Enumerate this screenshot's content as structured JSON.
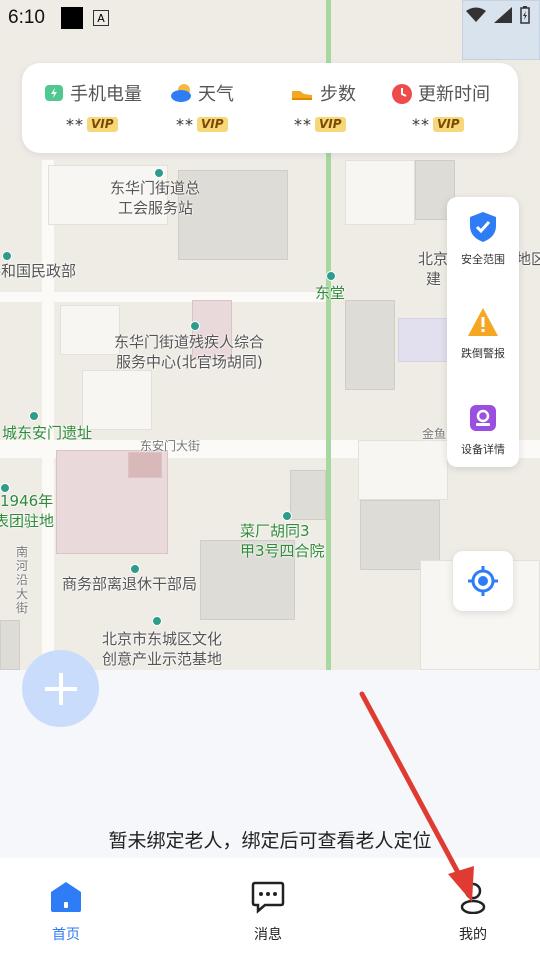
{
  "status_bar": {
    "time": "6:10",
    "a_icon": "A"
  },
  "metrics": [
    {
      "label": "手机电量",
      "value": "**",
      "badge": "VIP",
      "icon": "battery-icon"
    },
    {
      "label": "天气",
      "value": "**",
      "badge": "VIP",
      "icon": "weather-cloud-icon"
    },
    {
      "label": "步数",
      "value": "**",
      "badge": "VIP",
      "icon": "shoe-icon"
    },
    {
      "label": "更新时间",
      "value": "**",
      "badge": "VIP",
      "icon": "clock-icon"
    }
  ],
  "side_panel": {
    "safe_zone": "安全范围",
    "fall_alert": "跌倒警报",
    "device_details": "设备详情"
  },
  "map_labels": {
    "poi1_line1": "东华门街道总",
    "poi1_line2": "工会服务站",
    "poi2": "共和国民政部",
    "poi3": "东堂",
    "poi4_line1": "北京",
    "poi4_line2": "建",
    "poi5": "地区",
    "poi6_line1": "东华门街道残疾人综合",
    "poi6_line2": "服务中心(北官场胡同)",
    "poi7": "城东安门遗址",
    "street1": "东安门大街",
    "street2": "金鱼",
    "poi8_line1": "1946年",
    "poi8_line2": "表团驻地",
    "poi9_line1": "菜厂胡同3",
    "poi9_line2": "甲3号四合院",
    "street3": "南河沿大街",
    "poi10": "商务部离退休干部局",
    "poi11_line1": "北京市东城区文化",
    "poi11_line2": "创意产业示范基地"
  },
  "hint_text": "暂未绑定老人，绑定后可查看老人定位",
  "tabs": [
    {
      "label": "首页",
      "active": true
    },
    {
      "label": "消息",
      "active": false
    },
    {
      "label": "我的",
      "active": false
    }
  ],
  "colors": {
    "accent": "#2f7df6",
    "vip_bg": "#f6d77a",
    "arrow": "#e03b32"
  }
}
